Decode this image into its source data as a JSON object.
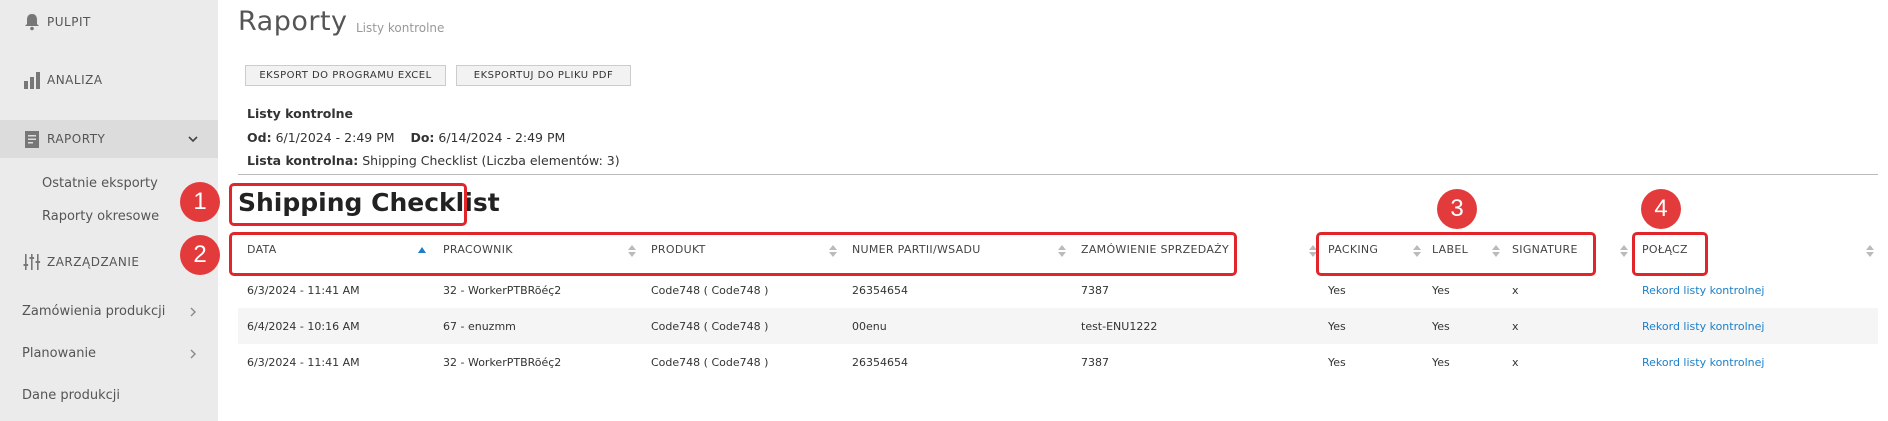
{
  "sidebar": {
    "items": [
      {
        "label": "PULPIT"
      },
      {
        "label": "ANALIZA"
      },
      {
        "label": "RAPORTY"
      },
      {
        "label": "ZARZĄDZANIE"
      }
    ],
    "subitems": [
      "Ostatnie eksporty",
      "Raporty okresowe"
    ],
    "links": [
      "Zamówienia produkcji",
      "Planowanie",
      "Dane produkcji"
    ]
  },
  "header": {
    "title": "Raporty",
    "subtitle": "Listy kontrolne"
  },
  "toolbar": {
    "excel_label": "EKSPORT DO PROGRAMU EXCEL",
    "pdf_label": "EKSPORTUJ DO PLIKU PDF"
  },
  "info": {
    "heading": "Listy kontrolne",
    "from_label": "Od:",
    "from_value": "6/1/2024 - 2:49 PM",
    "to_label": "Do:",
    "to_value": "6/14/2024 - 2:49 PM",
    "checklist_label": "Lista kontrolna:",
    "checklist_value": "Shipping Checklist (Liczba elementów: 3)"
  },
  "section": {
    "title": "Shipping Checklist"
  },
  "table": {
    "columns": [
      "DATA",
      "PRACOWNIK",
      "PRODUKT",
      "NUMER PARTII/WSADU",
      "ZAMÓWIENIE SPRZEDAŻY",
      "PACKING",
      "LABEL",
      "SIGNATURE",
      "POŁĄCZ"
    ],
    "rows": [
      [
        "6/3/2024 - 11:41 AM",
        "32 - WorkerPTBRõéç2",
        "Code748 ( Code748 )",
        "26354654",
        "7387",
        "Yes",
        "Yes",
        "x",
        "Rekord listy kontrolnej"
      ],
      [
        "6/4/2024 - 10:16 AM",
        "67 - enuzmm",
        "Code748 ( Code748 )",
        "00enu",
        "test-ENU1222",
        "Yes",
        "Yes",
        "x",
        "Rekord listy kontrolnej"
      ],
      [
        "6/3/2024 - 11:41 AM",
        "32 - WorkerPTBRõéç2",
        "Code748 ( Code748 )",
        "26354654",
        "7387",
        "Yes",
        "Yes",
        "x",
        "Rekord listy kontrolnej"
      ]
    ]
  },
  "annotations": [
    "1",
    "2",
    "3",
    "4"
  ],
  "colors": {
    "accent_link": "#1b7fc9",
    "annotation_red": "#e33b3b",
    "sidebar_bg": "#ebebeb"
  }
}
